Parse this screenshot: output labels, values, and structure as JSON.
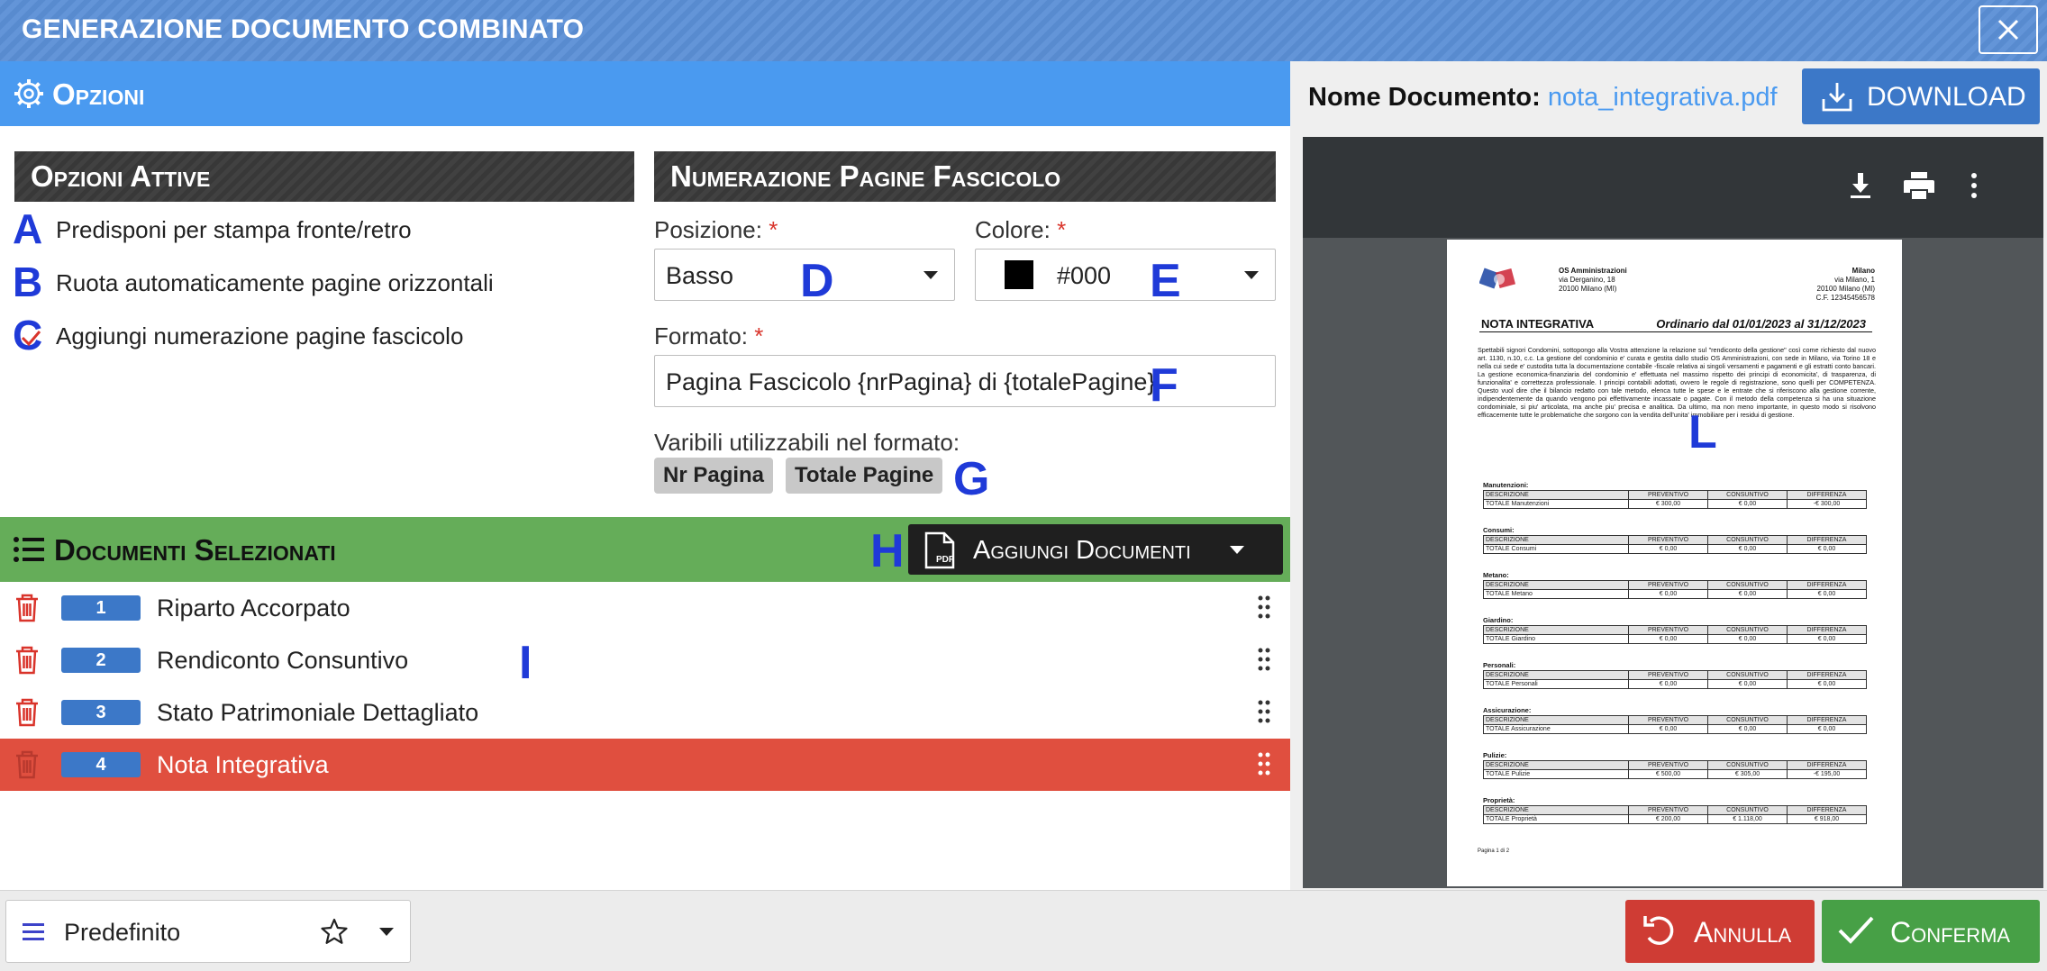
{
  "window": {
    "title": "GENERAZIONE DOCUMENTO COMBINATO",
    "close_icon": "close-icon"
  },
  "options": {
    "header": "Opzioni",
    "active": {
      "title": "Opzioni Attive",
      "items": [
        {
          "letter": "A",
          "label": "Predisponi per stampa fronte/retro",
          "checked": false
        },
        {
          "letter": "B",
          "label": "Ruota automaticamente pagine orizzontali",
          "checked": false
        },
        {
          "letter": "C",
          "label": "Aggiungi numerazione pagine fascicolo",
          "checked": true
        }
      ]
    },
    "numbering": {
      "title": "Numerazione Pagine Fascicolo",
      "position_label": "Posizione:",
      "position_value": "Basso",
      "position_letter": "D",
      "color_label": "Colore:",
      "color_value": "#000",
      "color_swatch": "#000000",
      "color_letter": "E",
      "format_label": "Formato:",
      "format_value": "Pagina Fascicolo {nrPagina} di {totalePagine}",
      "format_letter": "F",
      "vars_label": "Varibili utilizzabili nel formato:",
      "vars": [
        "Nr Pagina",
        "Totale Pagine"
      ],
      "vars_letter": "G",
      "required_mark": "*"
    }
  },
  "documents": {
    "header": "Documenti Selezionati",
    "add_letter": "H",
    "add_button": "Aggiungi Documenti",
    "list_letter": "I",
    "items": [
      {
        "num": "1",
        "name": "Riparto Accorpato",
        "active": false
      },
      {
        "num": "2",
        "name": "Rendiconto Consuntivo",
        "active": false
      },
      {
        "num": "3",
        "name": "Stato Patrimoniale Dettagliato",
        "active": false
      },
      {
        "num": "4",
        "name": "Nota Integrativa",
        "active": true
      }
    ]
  },
  "footer": {
    "preset": "Predefinito",
    "cancel": "Annulla",
    "confirm": "Conferma"
  },
  "preview": {
    "doc_label": "Nome Documento:",
    "doc_name": "nota_integrativa.pdf",
    "download": "DOWNLOAD",
    "letter": "L",
    "pdf": {
      "company": "OS Amministrazioni",
      "company_addr1": "via Derganino, 18",
      "company_addr2": "20100 Milano (MI)",
      "client": "Milano",
      "client_addr1": "via Milano, 1",
      "client_addr2": "20100 Milano (MI)",
      "client_cf": "C.F. 12345456578",
      "title": "NOTA INTEGRATIVA",
      "subtitle": "Ordinario dal 01/01/2023 al 31/12/2023",
      "body": "Spettabili signori Condomini, sottopongo alla Vostra attenzione la relazione sul \"rendiconto della gestione\" così come richiesto dal nuovo art. 1130, n.10, c.c. La gestione del condominio e' curata e gestita dallo studio OS Amministrazioni, con sede in Milano, via Torino 18 e nella cui sede e' custodita tutta la documentazione contabile -fiscale relativa ai singoli versamenti e pagamenti e gli estratti conto bancari. La gestione economica-finanziaria del condominio e' effettuata nel massimo rispetto dei principi di economicita', di trasparenza, di funzionalita' e correttezza professionale. I principi contabili adottati, ovvero le regole di registrazione, sono quelli per COMPETENZA. Questo vuol dire che il bilancio redatto con tale metodo, elenca tutte le spese e le entrate che si riferiscono alla gestione corrente, indipendentemente da quando vengono poi effettivamente incassate o pagate. Con il metodo della competenza si ha una situazione condominiale, si piu' articolata, ma anche piu' precisa e analitica. Da ultimo, ma non meno importante, in questo modo si risolvono efficacemente tutte le problematiche che sorgono con la vendita dell'unita' immobiliare per i residui di gestione.",
      "col_headers": [
        "DESCRIZIONE",
        "PREVENTIVO",
        "CONSUNTIVO",
        "DIFFERENZA"
      ],
      "sections": [
        {
          "name": "Manutenzioni:",
          "total": "TOTALE Manutenzioni",
          "prev": "€ 300,00",
          "cons": "€ 0,00",
          "diff": "-€ 300,00"
        },
        {
          "name": "Consumi:",
          "total": "TOTALE Consumi",
          "prev": "€ 0,00",
          "cons": "€ 0,00",
          "diff": "€ 0,00"
        },
        {
          "name": "Metano:",
          "total": "TOTALE Metano",
          "prev": "€ 0,00",
          "cons": "€ 0,00",
          "diff": "€ 0,00"
        },
        {
          "name": "Giardino:",
          "total": "TOTALE Giardino",
          "prev": "€ 0,00",
          "cons": "€ 0,00",
          "diff": "€ 0,00"
        },
        {
          "name": "Personali:",
          "total": "TOTALE Personali",
          "prev": "€ 0,00",
          "cons": "€ 0,00",
          "diff": "€ 0,00"
        },
        {
          "name": "Assicurazione:",
          "total": "TOTALE Assicurazione",
          "prev": "€ 0,00",
          "cons": "€ 0,00",
          "diff": "€ 0,00"
        },
        {
          "name": "Pulizie:",
          "total": "TOTALE Pulizie",
          "prev": "€ 500,00",
          "cons": "€ 305,00",
          "diff": "-€ 195,00"
        },
        {
          "name": "Proprietà:",
          "total": "TOTALE Proprietà",
          "prev": "€ 200,00",
          "cons": "€ 1.118,00",
          "diff": "€ 918,00"
        }
      ],
      "page_footer": "Pagina 1 di 2"
    }
  },
  "colors": {
    "accent": "#4a9af0",
    "docs_header": "#65ad59",
    "active_row": "#e04f3f",
    "cancel": "#cf3c34",
    "confirm": "#47a046",
    "marker": "#1f3ad8"
  }
}
